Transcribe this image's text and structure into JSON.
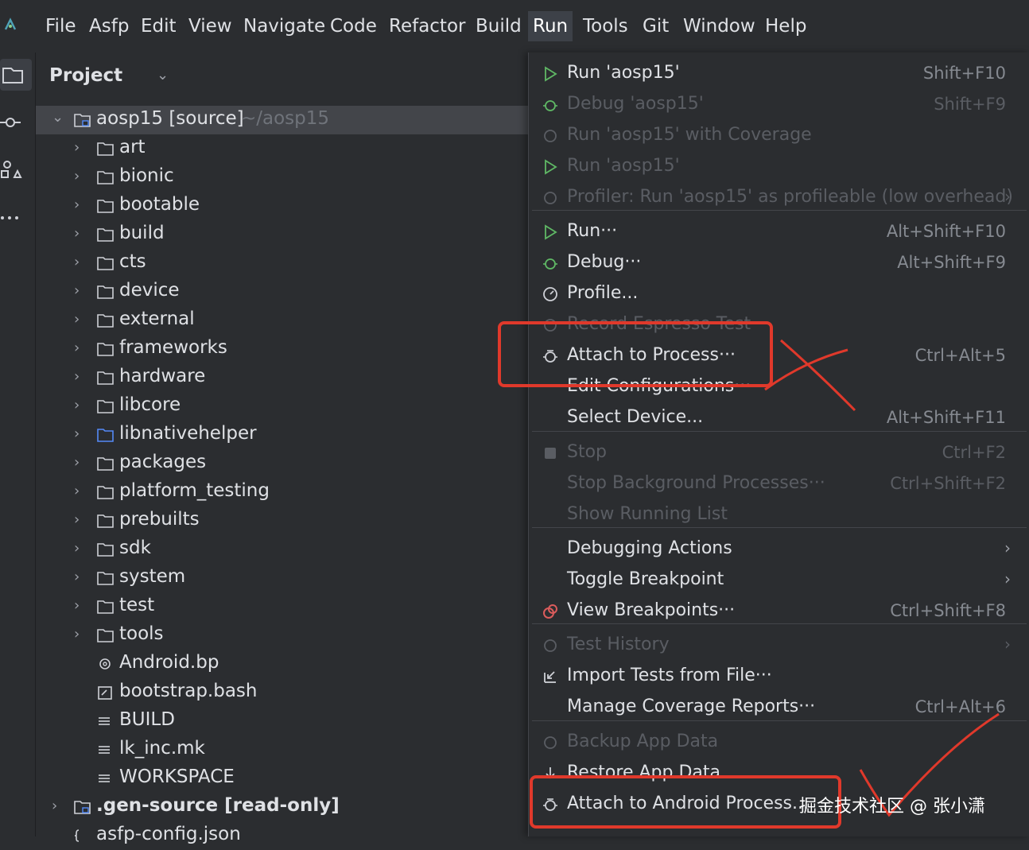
{
  "menubar": {
    "items": [
      {
        "label": "File"
      },
      {
        "label": "Asfp"
      },
      {
        "label": "Edit"
      },
      {
        "label": "View"
      },
      {
        "label": "Navigate"
      },
      {
        "label": "Code"
      },
      {
        "label": "Refactor"
      },
      {
        "label": "Build"
      },
      {
        "label": "Run"
      },
      {
        "label": "Tools"
      },
      {
        "label": "Git"
      },
      {
        "label": "Window"
      },
      {
        "label": "Help"
      }
    ],
    "active": "Run"
  },
  "toolstrip": {
    "icons": [
      "folder-icon",
      "commit-icon",
      "structure-icon",
      "more-icon"
    ]
  },
  "project": {
    "title": "Project",
    "root": {
      "label": "aosp15 [source]",
      "hint": "~/aosp15"
    },
    "folders": [
      {
        "label": "art"
      },
      {
        "label": "bionic"
      },
      {
        "label": "bootable"
      },
      {
        "label": "build"
      },
      {
        "label": "cts"
      },
      {
        "label": "device"
      },
      {
        "label": "external"
      },
      {
        "label": "frameworks"
      },
      {
        "label": "hardware"
      },
      {
        "label": "libcore"
      },
      {
        "label": "libnativehelper"
      },
      {
        "label": "packages"
      },
      {
        "label": "platform_testing"
      },
      {
        "label": "prebuilts"
      },
      {
        "label": "sdk"
      },
      {
        "label": "system"
      },
      {
        "label": "test"
      },
      {
        "label": "tools"
      }
    ],
    "files": [
      {
        "label": "Android.bp"
      },
      {
        "label": "bootstrap.bash"
      },
      {
        "label": "BUILD"
      },
      {
        "label": "lk_inc.mk"
      },
      {
        "label": "WORKSPACE"
      }
    ],
    "gen_source": {
      "label": ".gen-source [read-only]"
    },
    "last_file": {
      "label": "asfp-config.json"
    }
  },
  "run_menu": {
    "items": [
      {
        "label": "Run 'aosp15'",
        "shortcut": "Shift+F10",
        "disabled": false
      },
      {
        "label": "Debug 'aosp15'",
        "shortcut": "Shift+F9",
        "disabled": true
      },
      {
        "label": "Run 'aosp15' with Coverage",
        "shortcut": "",
        "disabled": true
      },
      {
        "label": "Run 'aosp15'",
        "shortcut": "",
        "disabled": true
      },
      {
        "label": "Profiler: Run 'aosp15' as profileable (low overhead)",
        "shortcut": "",
        "disabled": true
      },
      {
        "label": "Run···",
        "shortcut": "Alt+Shift+F10",
        "disabled": false
      },
      {
        "label": "Debug···",
        "shortcut": "Alt+Shift+F9",
        "disabled": false
      },
      {
        "label": "Profile...",
        "shortcut": "",
        "disabled": false
      },
      {
        "label": "Record Espresso Test",
        "shortcut": "",
        "disabled": true
      },
      {
        "label": "Attach to Process···",
        "shortcut": "Ctrl+Alt+5",
        "disabled": false
      },
      {
        "label": "Edit Configurations···",
        "shortcut": "",
        "disabled": false
      },
      {
        "label": "Select Device...",
        "shortcut": "Alt+Shift+F11",
        "disabled": false
      },
      {
        "label": "Stop",
        "shortcut": "Ctrl+F2",
        "disabled": true
      },
      {
        "label": "Stop Background Processes···",
        "shortcut": "Ctrl+Shift+F2",
        "disabled": true
      },
      {
        "label": "Show Running List",
        "shortcut": "",
        "disabled": true
      },
      {
        "label": "Debugging Actions",
        "shortcut": "",
        "disabled": false
      },
      {
        "label": "Toggle Breakpoint",
        "shortcut": "",
        "disabled": false
      },
      {
        "label": "View Breakpoints···",
        "shortcut": "Ctrl+Shift+F8",
        "disabled": false
      },
      {
        "label": "Test History",
        "shortcut": "",
        "disabled": true
      },
      {
        "label": "Import Tests from File···",
        "shortcut": "",
        "disabled": false
      },
      {
        "label": "Manage Coverage Reports···",
        "shortcut": "Ctrl+Alt+6",
        "disabled": false
      },
      {
        "label": "Backup App Data",
        "shortcut": "",
        "disabled": true
      },
      {
        "label": "Restore App Data",
        "shortcut": "",
        "disabled": false
      },
      {
        "label": "Attach to Android Process...",
        "shortcut": "",
        "disabled": false
      }
    ]
  },
  "watermark": "掘金技术社区 @ 张小潇",
  "colors": {
    "background": "#2b2d30",
    "selection": "#43454a",
    "annotation": "#e0392b",
    "run_green": "#5fb865",
    "folder_blue": "#548af7"
  }
}
